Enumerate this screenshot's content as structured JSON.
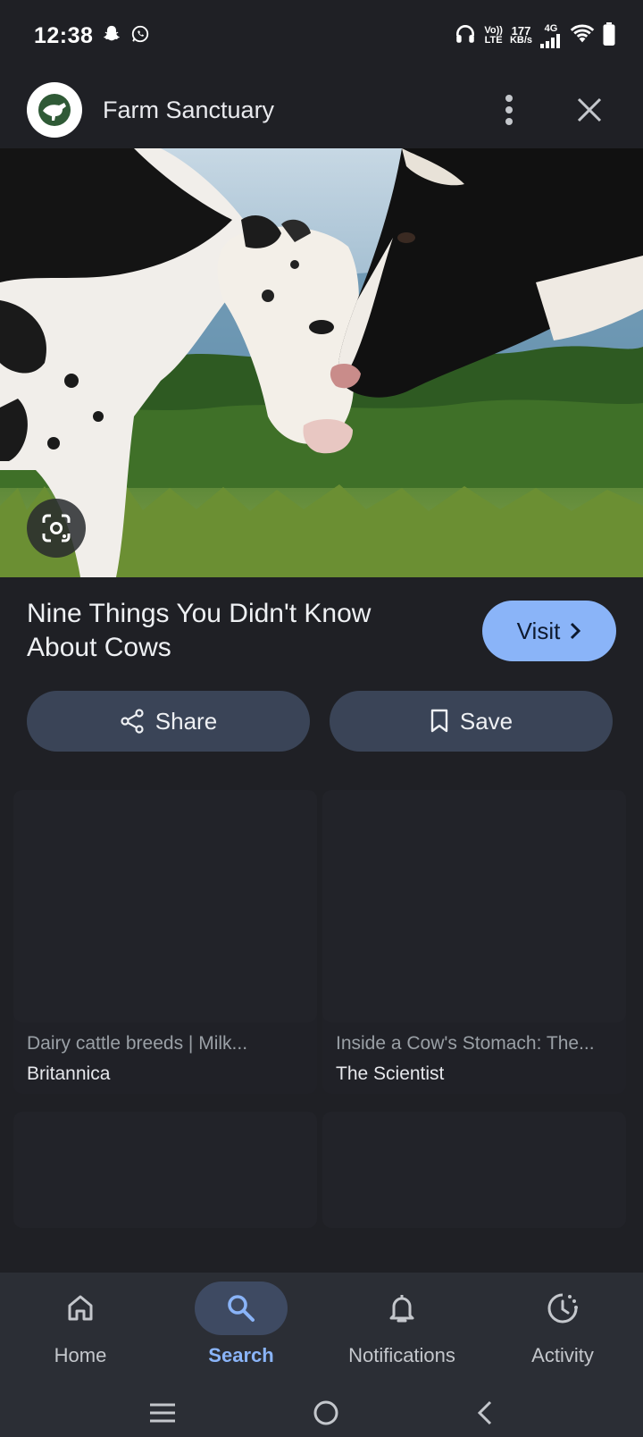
{
  "status_bar": {
    "time": "12:38",
    "network_top": "Vo))",
    "network_bottom": "LTE",
    "speed_value": "177",
    "speed_unit": "KB/s",
    "cell_label": "4G"
  },
  "header": {
    "site_name": "Farm Sanctuary",
    "logo_icon": "farm-sanctuary-logo",
    "brand_color": "#2f5a36"
  },
  "article": {
    "title": "Nine Things You Didn't Know About Cows",
    "visit_label": "Visit"
  },
  "actions": {
    "share_label": "Share",
    "save_label": "Save"
  },
  "related": [
    {
      "title": "Dairy cattle breeds | Milk...",
      "source": "Britannica"
    },
    {
      "title": "Inside a Cow's Stomach: The...",
      "source": "The Scientist"
    }
  ],
  "bottom_nav": {
    "items": [
      {
        "label": "Home",
        "icon": "home-icon",
        "active": false
      },
      {
        "label": "Search",
        "icon": "search-icon",
        "active": true
      },
      {
        "label": "Notifications",
        "icon": "bell-icon",
        "active": false
      },
      {
        "label": "Activity",
        "icon": "activity-icon",
        "active": false
      }
    ]
  },
  "colors": {
    "background": "#1f2025",
    "accent": "#8ab4f8",
    "button_bg": "#3a4457"
  }
}
